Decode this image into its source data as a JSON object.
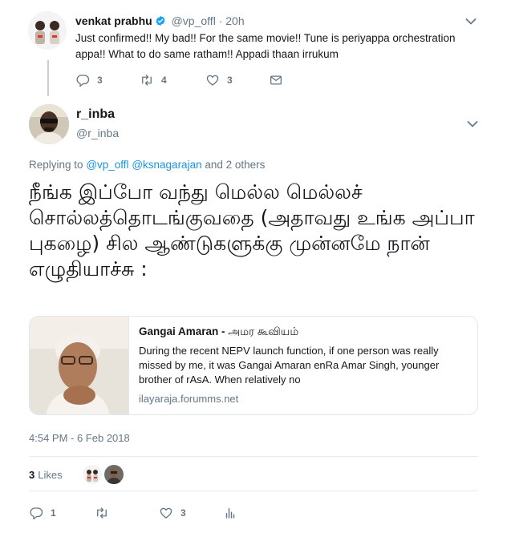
{
  "parent_tweet": {
    "author_name": "venkat prabhu",
    "handle": "@vp_offl",
    "separator": "·",
    "time": "20h",
    "text": "Just confirmed!! My bad!! For the same movie!! Tune is periyappa orchestration appa!! What to do same ratham!! Appadi thaan irrukum",
    "reply_count": "3",
    "retweet_count": "4",
    "like_count": "3"
  },
  "main_tweet": {
    "author_name": "r_inba",
    "handle": "@r_inba",
    "replying_prefix": "Replying to",
    "replying_mention_1": "@vp_offl",
    "replying_mention_2": "@ksnagarajan",
    "replying_suffix": "and 2 others",
    "text": "நீங்க இப்போ வந்து மெல்ல மெல்லச் சொல்லத்தொடங்குவதை (அதாவது உங்க அப்பா புகழை) சில ஆண்டுகளுக்கு முன்னமே நான் எழுதியாச்சு :",
    "card": {
      "title_en": "Gangai Amaran -",
      "title_ta": "அமர கூவியம்",
      "description": "During the recent NEPV launch function, if one person was really missed by me, it was Gangai Amaran enRa Amar Singh, younger brother of rAsA. When relatively no",
      "domain": "ilayaraja.forumms.net"
    },
    "timestamp": "4:54 PM - 6 Feb 2018",
    "likes_count": "3",
    "likes_label": "Likes",
    "reply_count": "1",
    "like_count": "3"
  },
  "colors": {
    "link": "#1b95e0",
    "secondary_text": "#657786",
    "verified": "#1da1f2",
    "divider": "#e6ecf0"
  },
  "icons": {
    "reply": "reply-icon",
    "retweet": "retweet-icon",
    "like": "heart-icon",
    "message": "envelope-icon",
    "analytics": "analytics-icon",
    "more": "chevron-down-icon",
    "verified": "verified-badge-icon"
  }
}
